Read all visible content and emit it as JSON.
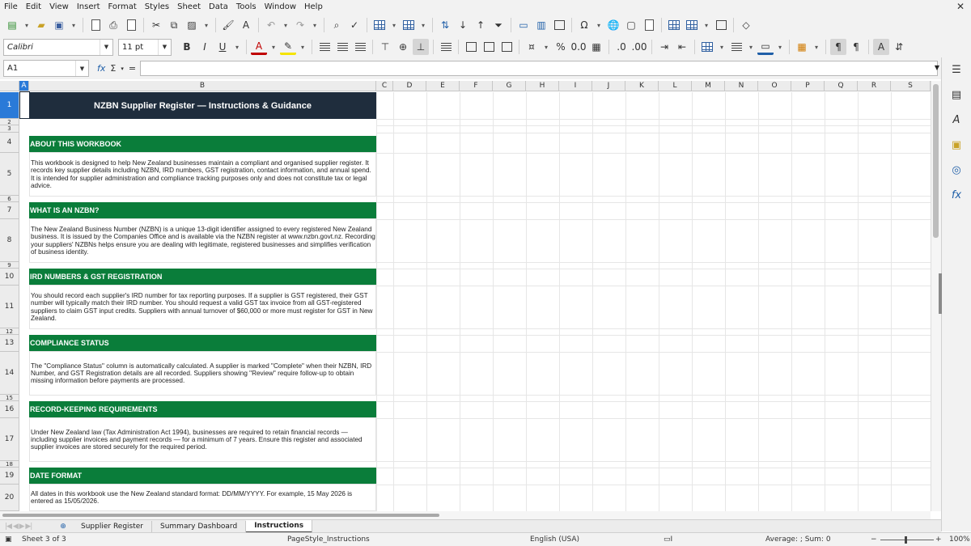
{
  "menu": [
    "File",
    "Edit",
    "View",
    "Insert",
    "Format",
    "Styles",
    "Sheet",
    "Data",
    "Tools",
    "Window",
    "Help"
  ],
  "toolbar": {
    "font_name": "Calibri",
    "font_size": "11 pt"
  },
  "formula_bar": {
    "cell_ref": "A1",
    "content": ""
  },
  "columns": [
    "A",
    "B",
    "C",
    "D",
    "E",
    "F",
    "G",
    "H",
    "I",
    "J",
    "K",
    "L",
    "M",
    "N",
    "O",
    "P",
    "Q",
    "R",
    "S"
  ],
  "rows": [
    "1",
    "2",
    "3",
    "4",
    "5",
    "6",
    "7",
    "8",
    "9",
    "10",
    "11",
    "12",
    "13",
    "14",
    "15",
    "16",
    "17",
    "18",
    "19",
    "20"
  ],
  "sheet": {
    "title": "NZBN Supplier Register — Instructions & Guidance",
    "sections": [
      {
        "heading": "ABOUT THIS WORKBOOK",
        "body": "This workbook is designed to help New Zealand businesses maintain a compliant and organised supplier register. It records key supplier details including NZBN, IRD numbers, GST registration, contact information, and annual spend. It is intended for supplier administration and compliance tracking purposes only and does not constitute tax or legal advice."
      },
      {
        "heading": "WHAT IS AN NZBN?",
        "body": "The New Zealand Business Number (NZBN) is a unique 13-digit identifier assigned to every registered New Zealand business. It is issued by the Companies Office and is available via the NZBN register at www.nzbn.govt.nz. Recording your suppliers' NZBNs helps ensure you are dealing with legitimate, registered businesses and simplifies verification of business identity."
      },
      {
        "heading": "IRD NUMBERS & GST REGISTRATION",
        "body": "You should record each supplier's IRD number for tax reporting purposes. If a supplier is GST registered, their GST number will typically match their IRD number. You should request a valid GST tax invoice from all GST-registered suppliers to claim GST input credits. Suppliers with annual turnover of $60,000 or more must register for GST in New Zealand."
      },
      {
        "heading": "COMPLIANCE STATUS",
        "body": "The \"Compliance Status\" column is automatically calculated. A supplier is marked \"Complete\" when their NZBN, IRD Number, and GST Registration details are all recorded. Suppliers showing \"Review\" require follow-up to obtain missing information before payments are processed."
      },
      {
        "heading": "RECORD-KEEPING REQUIREMENTS",
        "body": "Under New Zealand law (Tax Administration Act 1994), businesses are required to retain financial records — including supplier invoices and payment records — for a minimum of 7 years. Ensure this register and associated supplier invoices are stored securely for the required period."
      },
      {
        "heading": "DATE FORMAT",
        "body": "All dates in this workbook use the New Zealand standard format: DD/MM/YYYY. For example, 15 May 2026 is entered as 15/05/2026."
      }
    ]
  },
  "tabs": [
    "Supplier Register",
    "Summary Dashboard",
    "Instructions"
  ],
  "active_tab": "Instructions",
  "status": {
    "sheet": "Sheet 3 of 3",
    "page_style": "PageStyle_Instructions",
    "language": "English (USA)",
    "summary": "Average: ; Sum: 0",
    "zoom": "100%"
  }
}
